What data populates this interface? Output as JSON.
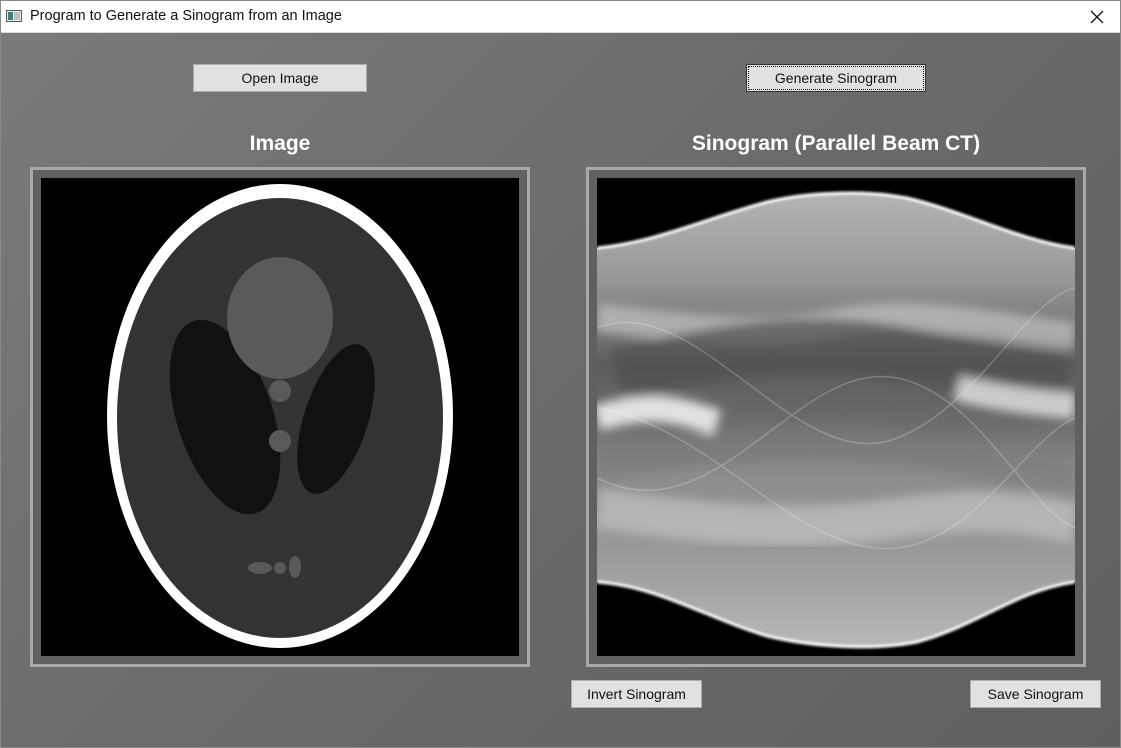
{
  "window": {
    "title": "Program to Generate a Sinogram from an Image",
    "close_glyph": "✕"
  },
  "toolbar": {
    "open_image_label": "Open Image",
    "generate_sinogram_label": "Generate Sinogram"
  },
  "panels": {
    "image": {
      "heading": "Image",
      "content": "shepp-logan-phantom"
    },
    "sinogram": {
      "heading": "Sinogram (Parallel Beam CT)",
      "content": "sinogram-render"
    }
  },
  "actions": {
    "invert_label": "Invert Sinogram",
    "save_label": "Save Sinogram"
  },
  "icons": {
    "app": "app-window-icon",
    "close": "close-icon"
  },
  "colors": {
    "background": "#6b6b6b",
    "button": "#e1e1e1",
    "frame_border": "#a9a9a9",
    "heading": "#ffffff"
  }
}
